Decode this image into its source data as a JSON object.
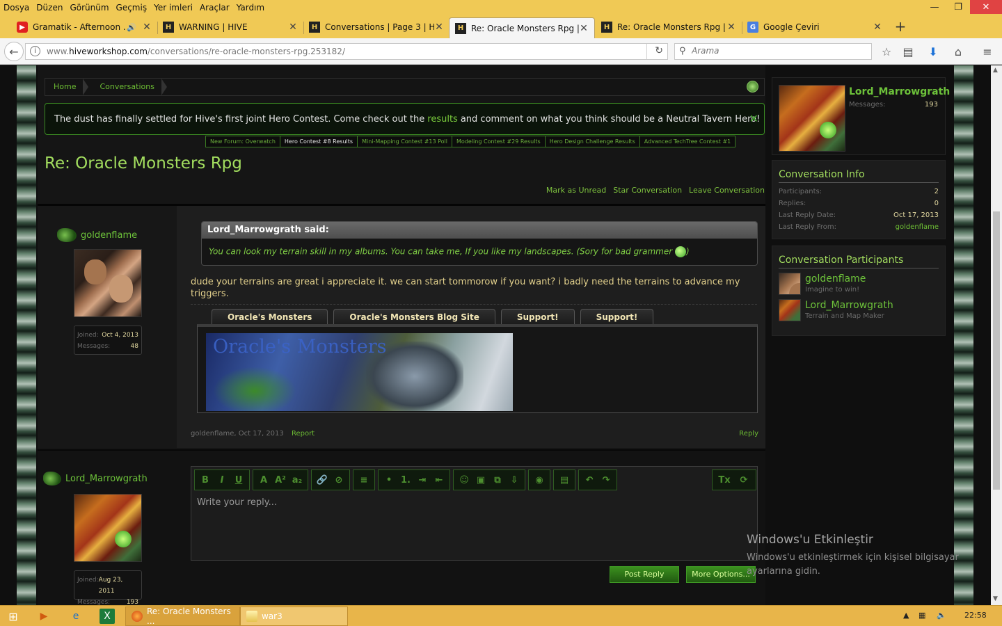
{
  "menu": [
    "Dosya",
    "Düzen",
    "Görünüm",
    "Geçmiş",
    "Yer imleri",
    "Araçlar",
    "Yardım"
  ],
  "window_controls": {
    "minimize": "—",
    "maximize": "❐",
    "close": "✕"
  },
  "tabs": [
    {
      "title": "Gramatik - Afternoon ...",
      "favicon": "youtube-icon",
      "fav_glyph": "▶",
      "audio": "🔊",
      "active": false
    },
    {
      "title": "WARNING | HIVE",
      "favicon": "hive-icon",
      "fav_glyph": "H",
      "active": false
    },
    {
      "title": "Conversations | Page 3 | H...",
      "favicon": "hive-icon",
      "fav_glyph": "H",
      "active": false
    },
    {
      "title": "Re: Oracle Monsters Rpg | ...",
      "favicon": "hive-icon",
      "fav_glyph": "H",
      "active": true
    },
    {
      "title": "Re: Oracle Monsters Rpg | ...",
      "favicon": "hive-icon",
      "fav_glyph": "H",
      "active": false
    },
    {
      "title": "Google Çeviri",
      "favicon": "google-translate-icon",
      "fav_glyph": "G",
      "active": false
    }
  ],
  "tab_close": "✕",
  "new_tab": "+",
  "address": {
    "prefix": "www.",
    "domain": "hiveworkshop.com",
    "path": "/conversations/re-oracle-monsters-rpg.253182/"
  },
  "search": {
    "placeholder": "Arama"
  },
  "breadcrumb": [
    "Home",
    "Conversations"
  ],
  "notice": {
    "before": "The dust has finally settled for Hive's first joint Hero Contest. Come check out the",
    "link": "results",
    "after": "and comment on what you think should be a Neutral Tavern Hero!",
    "close": "✕"
  },
  "subnav": [
    {
      "label": "New Forum: Overwatch",
      "active": false
    },
    {
      "label": "Hero Contest #8 Results",
      "active": true
    },
    {
      "label": "Mini-Mapping Contest #13 Poll",
      "active": false
    },
    {
      "label": "Modeling Contest #29 Results",
      "active": false
    },
    {
      "label": "Hero Design Challenge Results",
      "active": false
    },
    {
      "label": "Advanced TechTree Contest #1",
      "active": false
    }
  ],
  "page_title": "Re: Oracle Monsters Rpg",
  "conversation_actions": [
    "Mark as Unread",
    "Star Conversation",
    "Leave Conversation"
  ],
  "message": {
    "author": "goldenflame",
    "joined_label": "Joined:",
    "joined": "Oct 4, 2013",
    "messages_label": "Messages:",
    "messages": "48",
    "quote_author": "Lord_Marrowgrath said:",
    "quote_text": "You can look my terrain skill in my albums. You can take me, If you like my landscapes. (Sory for bad grammer ",
    "quote_end": ")",
    "body": "dude your terrains are great i appreciate it. we can start tommorow if you want? i badly need the terrains to advance my triggers.",
    "embed_tabs": [
      "Oracle's Monsters",
      "Oracle's Monsters Blog Site",
      "Support!",
      "Support!"
    ],
    "banner_title": "Oracle's Monsters",
    "footer_author": "goldenflame",
    "footer_date": "Oct 17, 2013",
    "report": "Report",
    "reply": "Reply"
  },
  "reply_user": {
    "name": "Lord_Marrowgrath",
    "joined_label": "Joined:",
    "joined": "Aug 23, 2011",
    "messages_label": "Messages:",
    "messages": "193"
  },
  "editor": {
    "placeholder": "Write your reply...",
    "toolbar_groups": [
      [
        "B",
        "I",
        "U"
      ],
      [
        "A",
        "A²",
        "a₂"
      ],
      [
        "🔗",
        "⊘"
      ],
      [
        "≡"
      ],
      [
        "•",
        "1.",
        "⇥",
        "⇤"
      ],
      [
        "☺",
        "▣",
        "⧉",
        "⇩"
      ],
      [
        "◉"
      ],
      [
        "▤"
      ],
      [
        "↶",
        "↷"
      ]
    ],
    "toolbar_right": [
      "Tx",
      "⟳"
    ],
    "post_reply": "Post Reply",
    "more_options": "More Options..."
  },
  "sidebar": {
    "visitor": {
      "name": "Lord_Marrowgrath",
      "messages_label": "Messages:",
      "messages": "193"
    },
    "info": {
      "title": "Conversation Info",
      "rows": [
        {
          "k": "Participants:",
          "v": "2",
          "green": false
        },
        {
          "k": "Replies:",
          "v": "0",
          "green": false
        },
        {
          "k": "Last Reply Date:",
          "v": "Oct 17, 2013",
          "green": false
        },
        {
          "k": "Last Reply From:",
          "v": "goldenflame",
          "green": true
        }
      ]
    },
    "participants": {
      "title": "Conversation Participants",
      "people": [
        {
          "name": "goldenflame",
          "title": "Imagine to win!"
        },
        {
          "name": "Lord_Marrowgrath",
          "title": "Terrain and Map Maker"
        }
      ]
    }
  },
  "watermark": {
    "title": "Windows'u Etkinleştir",
    "text": "Windows'u etkinleştirmek için kişisel bilgisayar ayarlarına gidin."
  },
  "taskbar": {
    "apps": [
      {
        "label": "Re: Oracle Monsters ...",
        "active": true
      },
      {
        "label": "war3",
        "active": false
      }
    ],
    "time": "22:58"
  }
}
